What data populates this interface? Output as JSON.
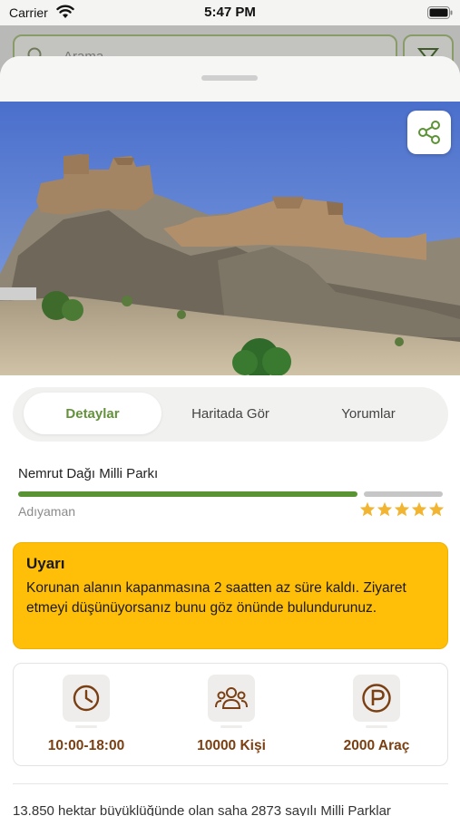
{
  "status_bar": {
    "carrier": "Carrier",
    "time": "5:47 PM"
  },
  "background": {
    "search_placeholder": "Arama"
  },
  "tabs": [
    {
      "label": "Detaylar",
      "active": true
    },
    {
      "label": "Haritada Gör",
      "active": false
    },
    {
      "label": "Yorumlar",
      "active": false
    }
  ],
  "park": {
    "name": "Nemrut Dağı Milli Parkı",
    "city": "Adıyaman",
    "rating": 5,
    "rating_max": 5
  },
  "warning": {
    "title": "Uyarı",
    "message": "Korunan alanın kapanmasına 2 saatten az süre kaldı. Ziyaret etmeyi düşünüyorsanız bunu göz önünde bulundurunuz."
  },
  "info": {
    "hours": {
      "icon": "clock-icon",
      "label": "10:00-18:00"
    },
    "capacity": {
      "icon": "people-icon",
      "label": "10000 Kişi"
    },
    "parking": {
      "icon": "parking-icon",
      "label": "2000 Araç"
    }
  },
  "description": "13.850 hektar büyüklüğünde olan saha 2873 sayılı Milli Parklar",
  "colors": {
    "accent_green": "#63923b",
    "warning_yellow": "#ffbf09",
    "info_brown": "#7a3f12",
    "star": "#f2b531"
  }
}
